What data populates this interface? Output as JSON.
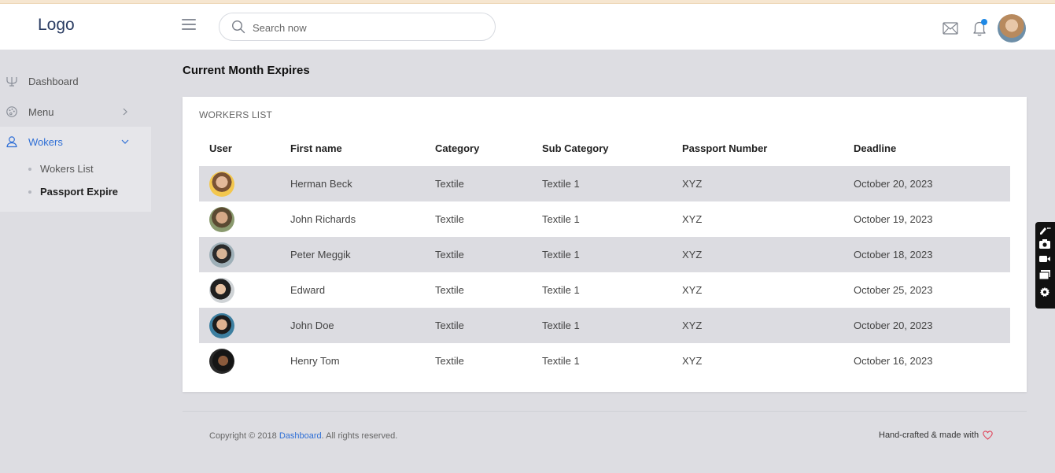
{
  "header": {
    "logo": "Logo",
    "search_placeholder": "Search now"
  },
  "sidebar": {
    "items": [
      {
        "label": "Dashboard",
        "icon": "dashboard-icon"
      },
      {
        "label": "Menu",
        "icon": "palette-icon"
      },
      {
        "label": "Wokers",
        "icon": "user-icon"
      }
    ],
    "sub_items": [
      {
        "label": "Wokers List"
      },
      {
        "label": "Passport Expire"
      }
    ]
  },
  "main": {
    "title": "Current Month Expires",
    "card_title": "WORKERS LIST",
    "columns": [
      "User",
      "First name",
      "Category",
      "Sub Category",
      "Passport Number",
      "Deadline"
    ],
    "rows": [
      {
        "first_name": "Herman Beck",
        "category": "Textile",
        "sub_category": "Textile 1",
        "passport": "XYZ",
        "deadline": "October 20, 2023"
      },
      {
        "first_name": "John Richards",
        "category": "Textile",
        "sub_category": "Textile 1",
        "passport": "XYZ",
        "deadline": "October 19, 2023"
      },
      {
        "first_name": "Peter Meggik",
        "category": "Textile",
        "sub_category": "Textile 1",
        "passport": "XYZ",
        "deadline": "October 18, 2023"
      },
      {
        "first_name": "Edward",
        "category": "Textile",
        "sub_category": "Textile 1",
        "passport": "XYZ",
        "deadline": "October 25, 2023"
      },
      {
        "first_name": "John Doe",
        "category": "Textile",
        "sub_category": "Textile 1",
        "passport": "XYZ",
        "deadline": "October 20, 2023"
      },
      {
        "first_name": "Henry Tom",
        "category": "Textile",
        "sub_category": "Textile 1",
        "passport": "XYZ",
        "deadline": "October 16, 2023"
      }
    ]
  },
  "footer": {
    "copyright_prefix": "Copyright © 2018 ",
    "copyright_link": "Dashboard",
    "copyright_suffix": ". All rights reserved.",
    "made_with": "Hand-crafted & made with"
  },
  "colors": {
    "accent": "#2f6fd6",
    "row_shade": "#dcdce1",
    "page_bg": "#dddde2",
    "heart": "#e0445a",
    "notification_dot": "#1e88e5"
  }
}
